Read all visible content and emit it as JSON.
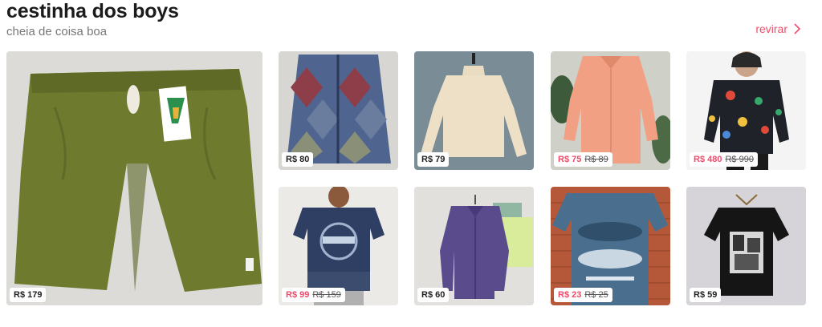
{
  "header": {
    "title": "cestinha dos boys",
    "subtitle": "cheia de coisa boa",
    "more_label": "revirar"
  },
  "products": [
    {
      "id": "shorts",
      "name": "shorts-verde",
      "price": "R$ 179",
      "old_price": ""
    },
    {
      "id": "cardigan",
      "name": "cardigan",
      "price": "R$ 80",
      "old_price": ""
    },
    {
      "id": "turtleneck",
      "name": "blusa-gola-alta",
      "price": "R$ 79",
      "old_price": ""
    },
    {
      "id": "pink-shirt",
      "name": "camisa-rosa",
      "price": "R$ 75",
      "old_price": "R$ 89"
    },
    {
      "id": "hoodie",
      "name": "moletom-estampado",
      "price": "R$ 480",
      "old_price": "R$ 990"
    },
    {
      "id": "redley-tee",
      "name": "camiseta-redley",
      "price": "R$ 99",
      "old_price": "R$ 159"
    },
    {
      "id": "purple-shirt",
      "name": "camisa-roxa",
      "price": "R$ 60",
      "old_price": ""
    },
    {
      "id": "blue-tee",
      "name": "camiseta-azul-surf",
      "price": "R$ 23",
      "old_price": "R$ 25"
    },
    {
      "id": "black-tee",
      "name": "camiseta-preta-estampada",
      "price": "R$ 59",
      "old_price": ""
    }
  ],
  "colors": {
    "accent": "#f04b6a",
    "title": "#1b1b1b",
    "subtitle": "#777777"
  },
  "icons": {
    "more": "chevron-right-icon"
  }
}
